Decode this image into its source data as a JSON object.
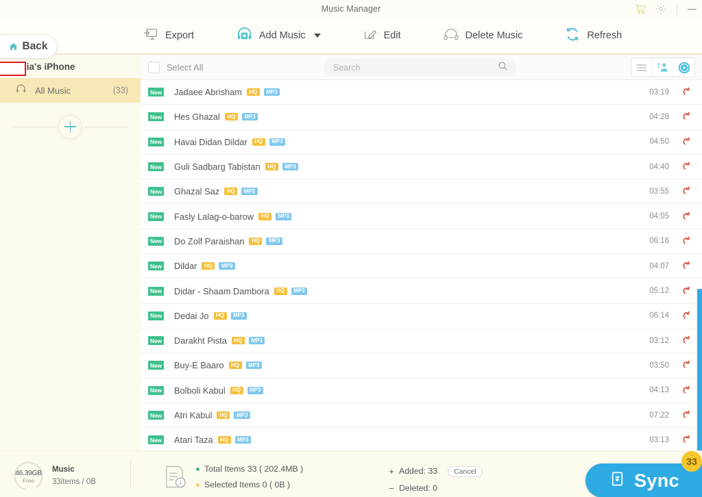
{
  "window": {
    "title": "Music Manager",
    "cart_icon": "cart-icon",
    "settings_icon": "gear-icon",
    "minimize_label": "Minimize"
  },
  "toolbar": {
    "back_label": "Back",
    "items": [
      {
        "label": "Export",
        "icon": "export-icon"
      },
      {
        "label": "Add Music",
        "icon": "add-music-icon",
        "has_caret": true
      },
      {
        "label": "Edit",
        "icon": "edit-icon"
      },
      {
        "label": "Delete Music",
        "icon": "delete-music-icon"
      },
      {
        "label": "Refresh",
        "icon": "refresh-icon"
      }
    ]
  },
  "sidebar": {
    "device_name": "zia's iPhone",
    "device_name_redacted": true,
    "eject_icon": "eject-icon",
    "items": [
      {
        "label": "All Music",
        "count": "(33)",
        "icon": "headphones-icon",
        "active": true
      }
    ],
    "add_playlist_label": "+"
  },
  "list_header": {
    "select_all_label": "Select All",
    "select_all_checked": false,
    "search_placeholder": "Search",
    "search_value": "",
    "search_icon": "search-icon",
    "view_buttons": [
      {
        "name": "list-view",
        "icon": "list-icon",
        "active": false
      },
      {
        "name": "artist-view",
        "icon": "artist-icon",
        "active": false
      },
      {
        "name": "album-view",
        "icon": "disc-icon",
        "active": true
      }
    ]
  },
  "songs": [
    {
      "badge": "New",
      "title": "Jadaee Abrisham",
      "quality": "HQ",
      "format": "MP3",
      "duration": "03:19"
    },
    {
      "badge": "New",
      "title": "Hes Ghazal",
      "quality": "HQ",
      "format": "MP3",
      "duration": "04:28"
    },
    {
      "badge": "New",
      "title": "Havai Didan Dildar",
      "quality": "HQ",
      "format": "MP3",
      "duration": "04:50"
    },
    {
      "badge": "New",
      "title": "Guli Sadbarg Tabistan",
      "quality": "HQ",
      "format": "MP3",
      "duration": "04:40"
    },
    {
      "badge": "New",
      "title": "Ghazal Saz",
      "quality": "HQ",
      "format": "MP3",
      "duration": "03:55"
    },
    {
      "badge": "New",
      "title": "Fasly Lalag-o-barow",
      "quality": "HQ",
      "format": "MP3",
      "duration": "04:05"
    },
    {
      "badge": "New",
      "title": "Do Zolf Paraishan",
      "quality": "HQ",
      "format": "MP3",
      "duration": "06:16"
    },
    {
      "badge": "New",
      "title": "Dildar",
      "quality": "HQ",
      "format": "MP3",
      "duration": "04:07"
    },
    {
      "badge": "New",
      "title": "Didar - Shaam Dambora",
      "quality": "HQ",
      "format": "MP3",
      "duration": "05:12"
    },
    {
      "badge": "New",
      "title": "Dedai Jo",
      "quality": "HQ",
      "format": "MP3",
      "duration": "06:14"
    },
    {
      "badge": "New",
      "title": "Darakht Pista",
      "quality": "HQ",
      "format": "MP3",
      "duration": "03:12"
    },
    {
      "badge": "New",
      "title": "Buy-E Baaro",
      "quality": "HQ",
      "format": "MP3",
      "duration": "03:50"
    },
    {
      "badge": "New",
      "title": "Bolboli Kabul",
      "quality": "HQ",
      "format": "MP3",
      "duration": "04:13"
    },
    {
      "badge": "New",
      "title": "Atri Kabul",
      "quality": "HQ",
      "format": "MP3",
      "duration": "07:22"
    },
    {
      "badge": "New",
      "title": "Atari Taza",
      "quality": "HQ",
      "format": "MP3",
      "duration": "03:13"
    }
  ],
  "bottom": {
    "storage_free": "46.39GB",
    "storage_free_sub": "Free",
    "category_title": "Music",
    "category_items": "33items / 0B",
    "total_items": "Total Items 33 ( 202.4MB )",
    "selected_items": "Selected Items 0 ( 0B )",
    "added": "Added: 33",
    "deleted": "Deleted: 0",
    "added_sign": "+",
    "deleted_sign": "−",
    "cancel_label": "Cancel",
    "sync_label": "Sync",
    "sync_badge": "33",
    "sync_icon": "sync-icon",
    "info_icon": "document-info-icon"
  },
  "colors": {
    "accent_blue": "#2fabe3",
    "sidebar_bg": "#fdfaee",
    "active_item": "#f7e9b6",
    "badge_new": "#3fc08c",
    "badge_hq": "#f5bf3c",
    "badge_format": "#7fc8ec",
    "sync_badge": "#f6c62d",
    "redact_border": "#e01b24"
  }
}
